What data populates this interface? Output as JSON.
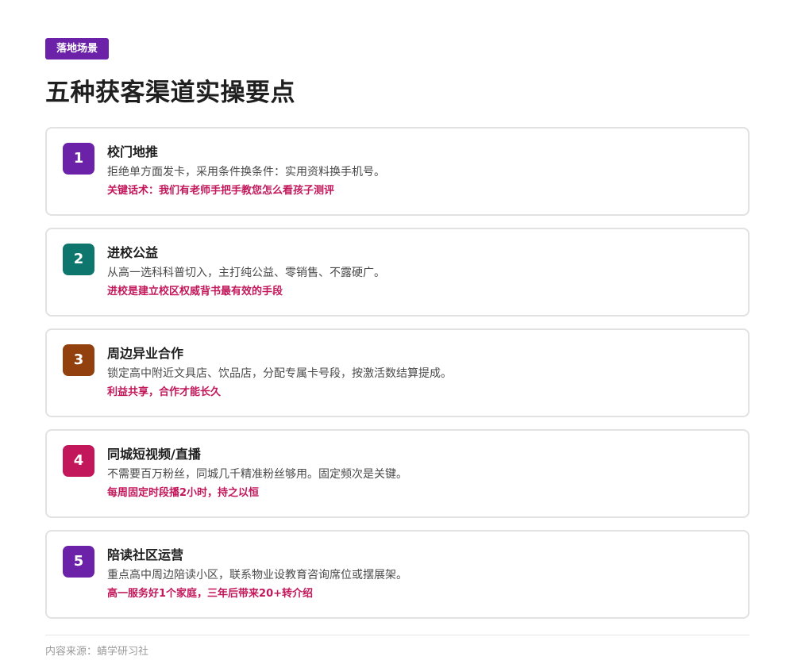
{
  "tag": "落地场景",
  "title": "五种获客渠道实操要点",
  "accent_note_color": "#c2185b",
  "cards": [
    {
      "number": "1",
      "color": "#6b21a8",
      "title": "校门地推",
      "desc": "拒绝单方面发卡，采用条件换条件：实用资料换手机号。",
      "note": "关键话术：我们有老师手把手教您怎么看孩子测评"
    },
    {
      "number": "2",
      "color": "#0f766e",
      "title": "进校公益",
      "desc": "从高一选科科普切入，主打纯公益、零销售、不露硬广。",
      "note": "进校是建立校区权威背书最有效的手段"
    },
    {
      "number": "3",
      "color": "#92400e",
      "title": "周边异业合作",
      "desc": "锁定高中附近文具店、饮品店，分配专属卡号段，按激活数结算提成。",
      "note": "利益共享，合作才能长久"
    },
    {
      "number": "4",
      "color": "#c2185b",
      "title": "同城短视频/直播",
      "desc": "不需要百万粉丝，同城几千精准粉丝够用。固定频次是关键。",
      "note": "每周固定时段播2小时，持之以恒"
    },
    {
      "number": "5",
      "color": "#6b21a8",
      "title": "陪读社区运营",
      "desc": "重点高中周边陪读小区，联系物业设教育咨询席位或摆展架。",
      "note": "高一服务好1个家庭，三年后带来20+转介绍"
    }
  ],
  "footer": "内容来源：蜻学研习社"
}
